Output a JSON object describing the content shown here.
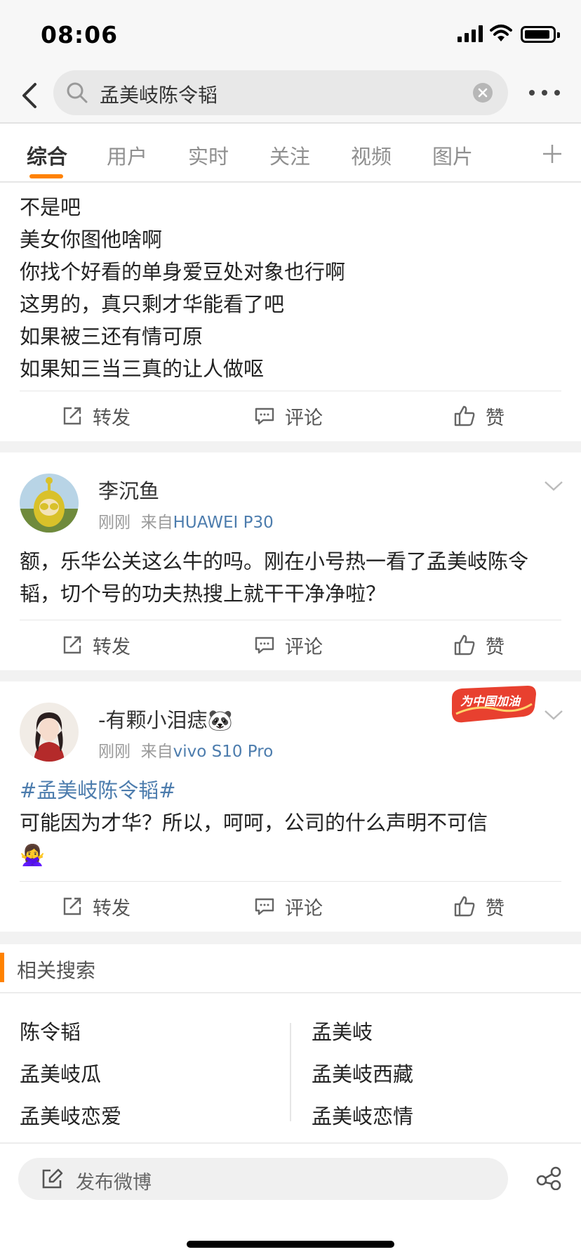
{
  "status": {
    "time": "08:06"
  },
  "search": {
    "query": "孟美岐陈令韬"
  },
  "tabs": [
    "综合",
    "用户",
    "实时",
    "关注",
    "视频",
    "图片"
  ],
  "post1": {
    "lines": [
      "不是吧",
      "美女你图他啥啊",
      "你找个好看的单身爱豆处对象也行啊",
      "这男的，真只剩才华能看了吧",
      "如果被三还有情可原",
      "如果知三当三真的让人做呕"
    ]
  },
  "actions": {
    "repost": "转发",
    "comment": "评论",
    "like": "赞"
  },
  "post2": {
    "user": "李沉鱼",
    "time": "刚刚",
    "from": "来自",
    "device": "HUAWEI P30",
    "text": "额，乐华公关这么牛的吗。刚在小号热一看了孟美岐陈令韬，切个号的功夫热搜上就干干净净啦？"
  },
  "post3": {
    "user": "-有颗小泪痣🐼",
    "time": "刚刚",
    "from": "来自",
    "device": "vivo S10 Pro",
    "hashtag": "#孟美岐陈令韬#",
    "text": "可能因为才华？所以，呵呵，公司的什么声明不可信",
    "emoji": "🙅‍♀️",
    "badge": "为中国加油"
  },
  "related": {
    "title": "相关搜索",
    "left": [
      "陈令韬",
      "孟美岐瓜",
      "孟美岐恋爱"
    ],
    "right": [
      "孟美岐",
      "孟美岐西藏",
      "孟美岐恋情"
    ]
  },
  "compose": {
    "placeholder": "发布微博"
  },
  "colors": {
    "accent": "#ff8200",
    "link": "#4c7cad",
    "badge": "#e8402f"
  }
}
